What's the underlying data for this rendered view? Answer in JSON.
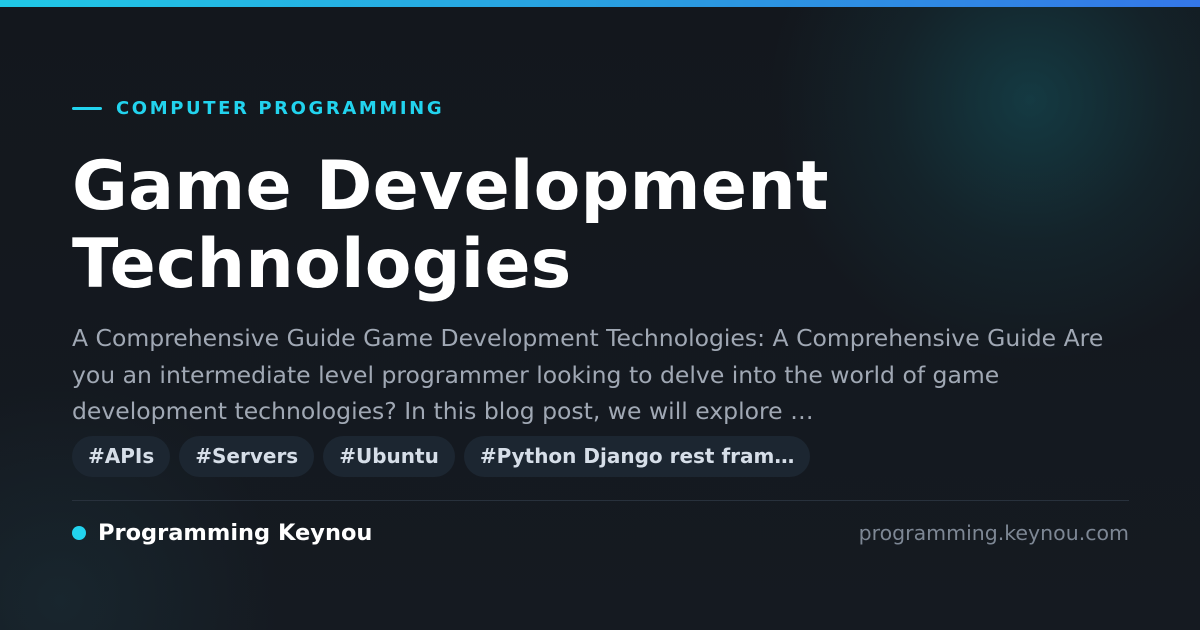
{
  "header": {
    "category": "COMPUTER PROGRAMMING",
    "title": "Game Development Technologies"
  },
  "article": {
    "description": "A Comprehensive Guide Game Development Technologies: A Comprehensive Guide Are you an intermediate level programmer looking to delve into the world of game development technologies? In this blog post, we will explore …"
  },
  "tags": [
    {
      "label": "#APIs"
    },
    {
      "label": "#Servers"
    },
    {
      "label": "#Ubuntu"
    },
    {
      "label": "#Python Django rest fram…"
    }
  ],
  "footer": {
    "brand": "Programming Keynou",
    "url": "programming.keynou.com"
  },
  "colors": {
    "accent": "#22d3ee",
    "background": "#141920",
    "title": "#ffffff",
    "description": "#a0a8b4",
    "tag_background": "#1c2631",
    "tag_text": "#d6dee8",
    "url": "#7d8794"
  }
}
